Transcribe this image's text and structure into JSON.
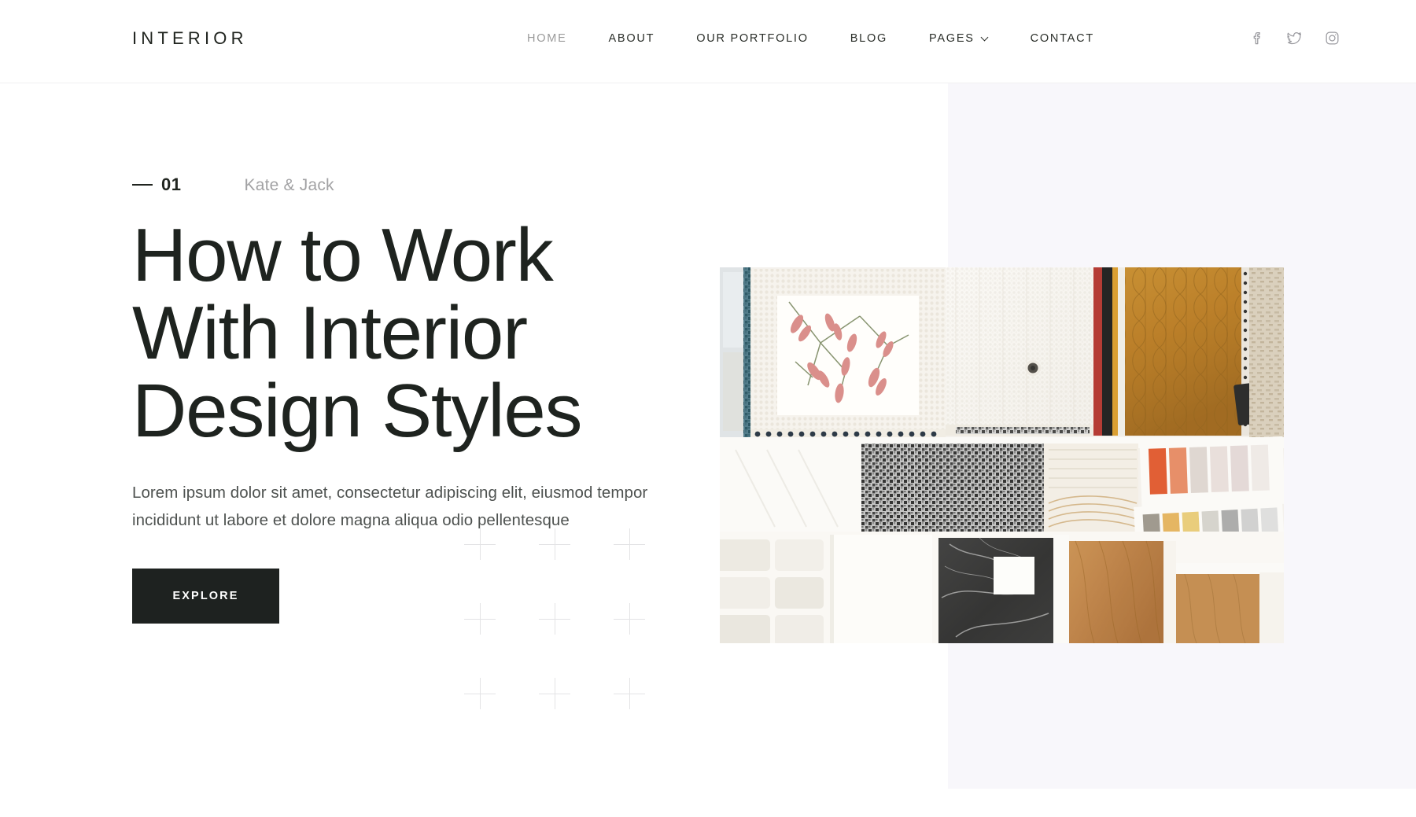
{
  "header": {
    "brand": "INTERIOR",
    "nav": [
      {
        "label": "HOME",
        "active": true,
        "caret": false
      },
      {
        "label": "ABOUT",
        "active": false,
        "caret": false
      },
      {
        "label": "OUR PORTFOLIO",
        "active": false,
        "caret": false
      },
      {
        "label": "BLOG",
        "active": false,
        "caret": false
      },
      {
        "label": "PAGES",
        "active": false,
        "caret": true
      },
      {
        "label": "CONTACT",
        "active": false,
        "caret": false
      }
    ],
    "socials": [
      {
        "name": "facebook-icon"
      },
      {
        "name": "twitter-icon"
      },
      {
        "name": "instagram-icon"
      }
    ]
  },
  "hero": {
    "slide_number": "01",
    "author": "Kate & Jack",
    "title_lines": [
      "How to Work",
      "With Interior",
      "Design Styles"
    ],
    "description": "Lorem ipsum dolor sit amet, consectetur adipiscing elit, eiusmod tempor incididunt ut labore et dolore magna aliqua odio pellentesque",
    "cta_label": "EXPLORE",
    "image_alt": "Flat lay of interior design material samples: fabric swatches, floral print, quilted ochre textile, marble tile, wood samples and a paint colour swatch card"
  },
  "colors": {
    "accent_dark": "#1e2220",
    "text_primary": "#1e231f",
    "text_muted": "#a2a2a4",
    "panel_bg": "#f8f7fb",
    "decor_plus": "#e3e3e5",
    "page_bg": "#ffffff"
  }
}
